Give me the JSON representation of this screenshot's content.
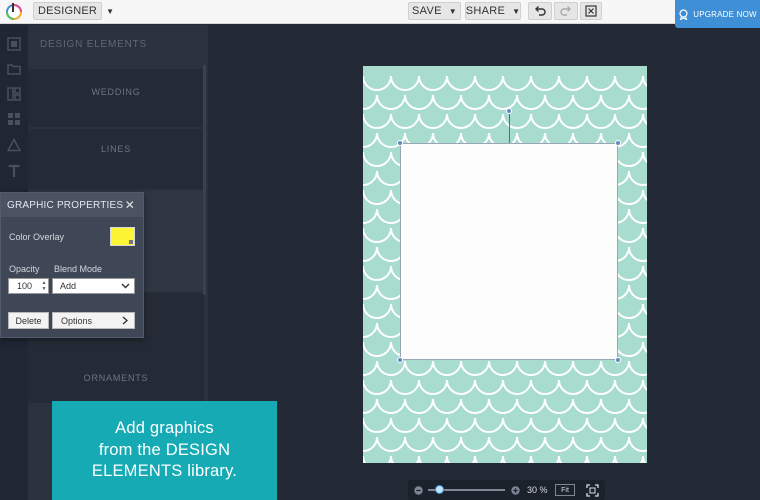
{
  "topbar": {
    "mode_label": "DESIGNER",
    "save_label": "SAVE",
    "share_label": "SHARE",
    "upgrade_label": "UPGRADE NOW"
  },
  "rail": {
    "icons": [
      "layers-icon",
      "folder-icon",
      "layout-icon",
      "grid-icon",
      "shapes-icon",
      "text-icon"
    ]
  },
  "library": {
    "title": "DESIGN ELEMENTS",
    "categories": [
      "WEDDING",
      "LINES",
      "ORNAMENTS"
    ]
  },
  "properties": {
    "title": "GRAPHIC PROPERTIES",
    "color_overlay_label": "Color Overlay",
    "color_overlay_value": "#fbf534",
    "opacity_label": "Opacity",
    "opacity_value": "100",
    "blend_mode_label": "Blend Mode",
    "blend_mode_value": "Add",
    "delete_label": "Delete",
    "options_label": "Options"
  },
  "callout": {
    "lines": [
      "Add graphics",
      "from the DESIGN",
      "ELEMENTS library."
    ]
  },
  "canvas": {
    "background_color": "#a8dccf",
    "pattern_color": "#ffffff"
  },
  "zoom": {
    "level": 30,
    "level_label": "30 %",
    "fit_label": "Fit"
  },
  "colors": {
    "accent": "#3f8fd6",
    "callout": "#16aab4",
    "workspace": "#232a36"
  }
}
